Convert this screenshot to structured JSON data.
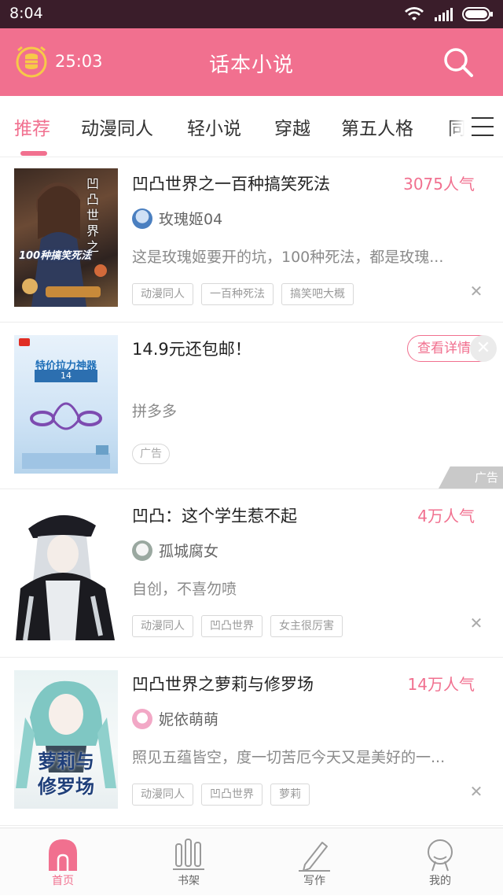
{
  "status_bar": {
    "time": "8:04"
  },
  "app_bar": {
    "timer": "25:03",
    "title": "话本小说"
  },
  "tabs": [
    "推荐",
    "动漫同人",
    "轻小说",
    "穿越",
    "第五人格",
    "同"
  ],
  "cards": [
    {
      "title": "凹凸世界之一百种搞笑死法",
      "popularity": "3075人气",
      "author": "玫瑰姬04",
      "description": "这是玫瑰姬要开的坑，100种死法，都是玫瑰...",
      "tags": [
        "动漫同人",
        "一百种死法",
        "搞笑吧大概"
      ],
      "cover_text": "凹凸世界之",
      "cover_sub": "100种搞笑死法"
    },
    {
      "title": "凹凸：这个学生惹不起",
      "popularity": "4万人气",
      "author": "孤城腐女",
      "description": "自创，不喜勿喷",
      "tags": [
        "动漫同人",
        "凹凸世界",
        "女主很厉害"
      ]
    },
    {
      "title": "凹凸世界之萝莉与修罗场",
      "popularity": "14万人气",
      "author": "妮依萌萌",
      "description": "照见五蕴皆空，度一切苦厄今天又是美好的一...",
      "tags": [
        "动漫同人",
        "凹凸世界",
        "萝莉"
      ],
      "cover_text": "萝莉与",
      "cover_sub": "修罗场"
    }
  ],
  "ad": {
    "title": "14.9元还包邮！",
    "detail_button": "查看详情",
    "source": "拼多多",
    "tag": "广告",
    "mark": "广告",
    "banner_title": "特价拉力神器",
    "price_tag": "14"
  },
  "bottom_nav": [
    "首页",
    "书架",
    "写作",
    "我的"
  ],
  "colors": {
    "accent": "#f1708f",
    "status_bar": "#3a1d2a"
  }
}
